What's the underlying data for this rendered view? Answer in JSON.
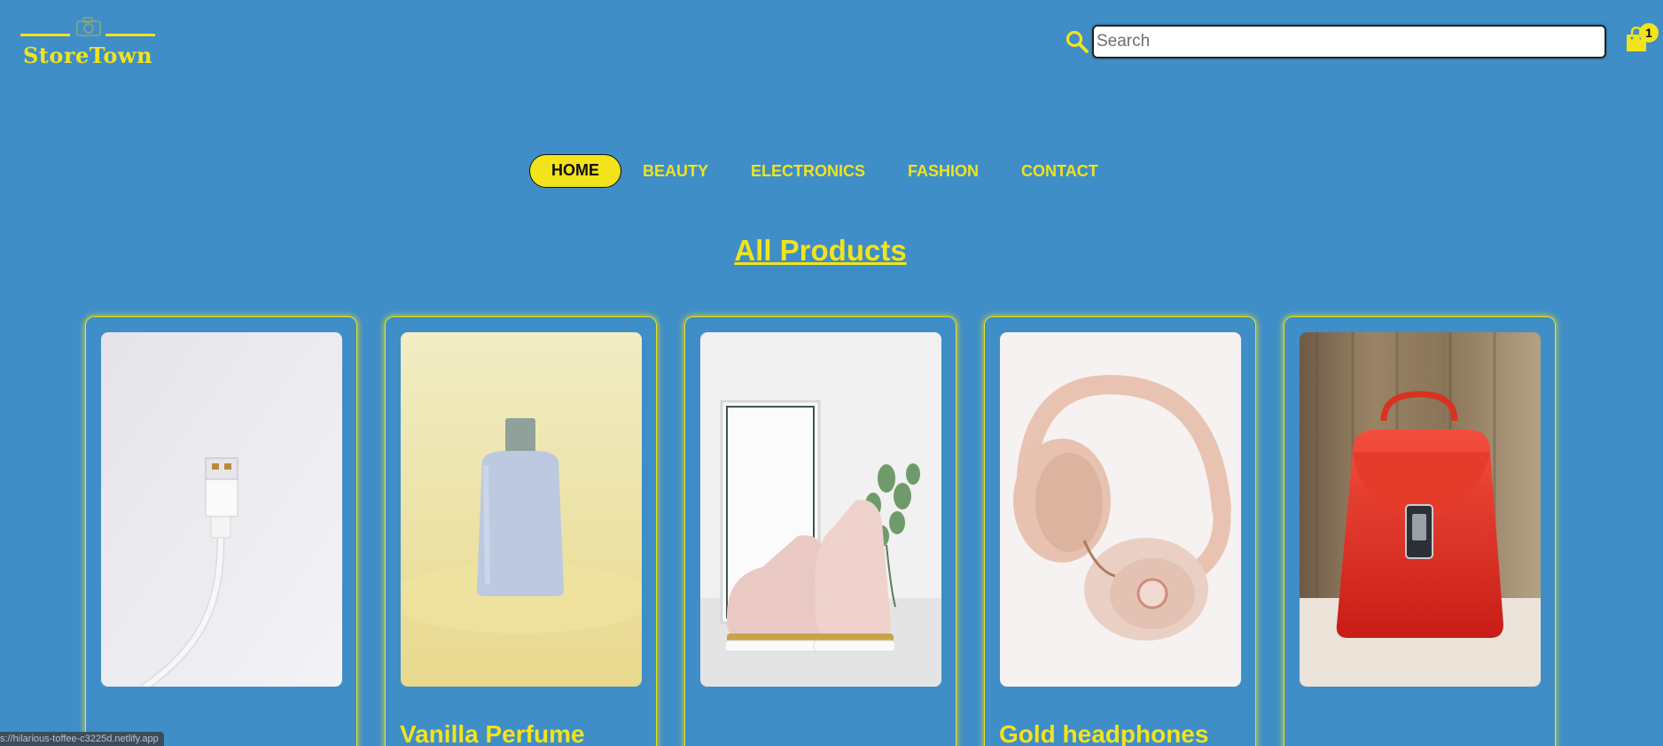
{
  "brand": {
    "name": "StoreTown",
    "color": "#f2e31a"
  },
  "header": {
    "search_icon": "search-icon",
    "search_placeholder": "Search",
    "search_value": "",
    "cart_icon": "shopping-bag-icon",
    "cart_count": "1"
  },
  "nav": {
    "items": [
      {
        "label": "HOME",
        "active": true
      },
      {
        "label": "BEAUTY",
        "active": false
      },
      {
        "label": "ELECTRONICS",
        "active": false
      },
      {
        "label": "FASHION",
        "active": false
      },
      {
        "label": "CONTACT",
        "active": false
      }
    ]
  },
  "main": {
    "title": "All Products",
    "products": [
      {
        "name": "",
        "image": "usb-cable-photo"
      },
      {
        "name": "Vanilla Perfume",
        "image": "perfume-bottle-photo"
      },
      {
        "name": "",
        "image": "pink-shoes-photo"
      },
      {
        "name": "Gold headphones",
        "image": "headphones-photo"
      },
      {
        "name": "",
        "image": "red-handbag-photo"
      }
    ]
  },
  "status_bar": {
    "url": "s://hilarious-toffee-c3225d.netlify.app"
  },
  "colors": {
    "background": "#3f8ec8",
    "accent": "#f2e31a"
  }
}
